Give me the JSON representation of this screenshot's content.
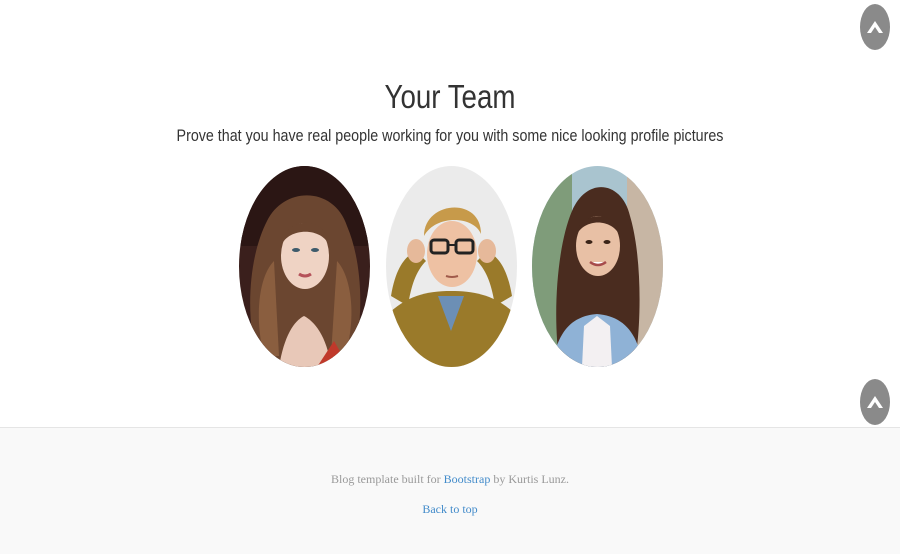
{
  "team": {
    "title": "Your Team",
    "subtitle": "Prove that you have real people working for you with some nice looking profile pictures",
    "members": [
      {
        "icon": "woman-curly-hair-portrait"
      },
      {
        "icon": "man-glasses-portrait"
      },
      {
        "icon": "woman-long-hair-portrait"
      }
    ]
  },
  "footer": {
    "credit_prefix": "Blog template built for ",
    "credit_link": "Bootstrap",
    "credit_suffix": " by Kurtis Lunz.",
    "back_to_top": "Back to top"
  },
  "scroll_buttons": [
    {
      "icon": "chevron-up-icon"
    },
    {
      "icon": "chevron-up-icon"
    }
  ],
  "colors": {
    "link": "#428bca",
    "footer_bg": "#f9f9f9",
    "scroll_btn": "#8a8a8a",
    "heading": "#333333"
  }
}
